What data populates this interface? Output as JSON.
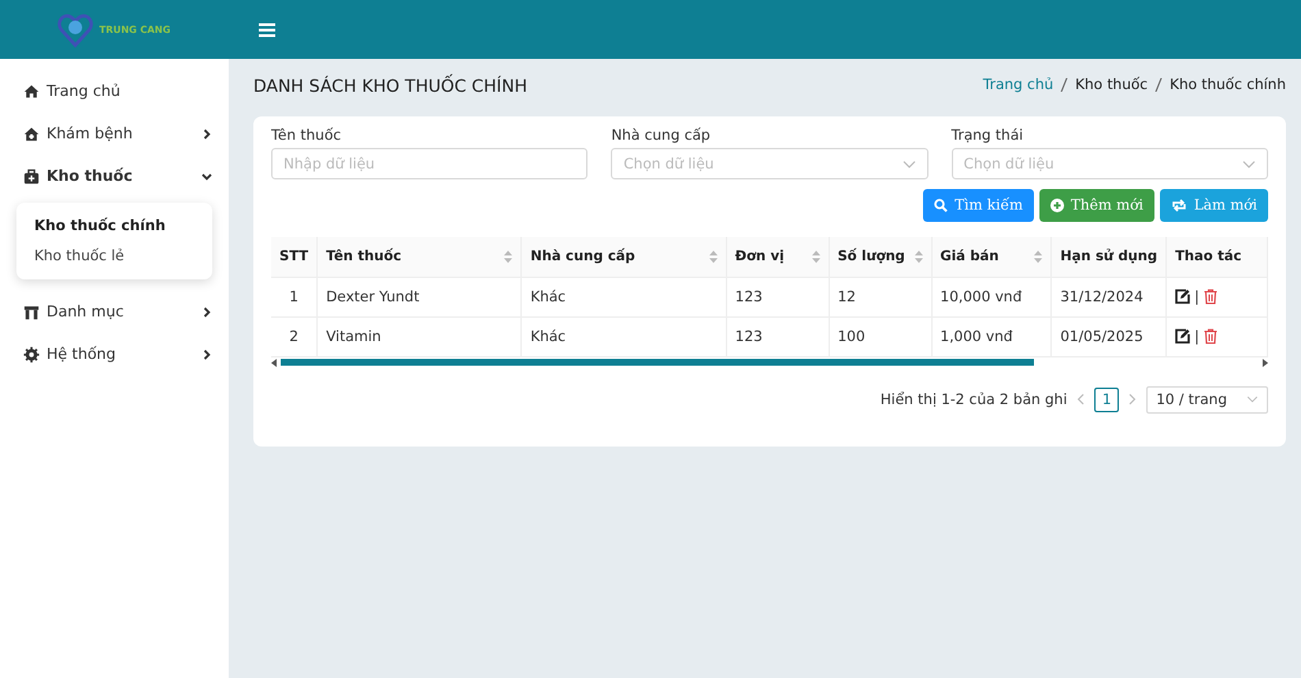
{
  "logo": {
    "text": "TRUNG CANG"
  },
  "page_title": "DANH SÁCH KHO THUỐC CHÍNH",
  "breadcrumb": [
    {
      "label": "Trang chủ",
      "kind": "link"
    },
    {
      "label": "Kho thuốc",
      "kind": "text"
    },
    {
      "label": "Kho thuốc chính",
      "kind": "text"
    }
  ],
  "sidebar": {
    "items": [
      {
        "label": "Trang chủ",
        "kind": "link",
        "active": false
      },
      {
        "label": "Khám bệnh",
        "kind": "group",
        "expanded": false,
        "active": false
      },
      {
        "label": "Kho thuốc",
        "kind": "group",
        "expanded": true,
        "active": true,
        "children": [
          {
            "label": "Kho thuốc chính",
            "selected": true
          },
          {
            "label": "Kho thuốc lẻ",
            "selected": false
          }
        ]
      },
      {
        "label": "Danh mục",
        "kind": "group",
        "expanded": false,
        "active": false
      },
      {
        "label": "Hệ thống",
        "kind": "group",
        "expanded": false,
        "active": false
      }
    ]
  },
  "filters": [
    {
      "label": "Tên thuốc",
      "kind": "input",
      "placeholder": "Nhập dữ liệu"
    },
    {
      "label": "Nhà cung cấp",
      "kind": "select",
      "placeholder": "Chọn dữ liệu"
    },
    {
      "label": "Trạng thái",
      "kind": "select",
      "placeholder": "Chọn dữ liệu"
    }
  ],
  "buttons": [
    {
      "label": "Tìm kiếm",
      "kind": "search",
      "color": "#1890ff"
    },
    {
      "label": "Thêm mới",
      "kind": "add",
      "color": "#3e9e47"
    },
    {
      "label": "Làm mới",
      "kind": "refresh",
      "color": "#1ba3dc"
    }
  ],
  "table": {
    "columns": [
      {
        "label": "STT",
        "sortable": false
      },
      {
        "label": "Tên thuốc",
        "sortable": true
      },
      {
        "label": "Nhà cung cấp",
        "sortable": true
      },
      {
        "label": "Đơn vị",
        "sortable": true
      },
      {
        "label": "Số lượng",
        "sortable": true
      },
      {
        "label": "Giá bán",
        "sortable": true
      },
      {
        "label": "Hạn sử dụng",
        "sortable": false
      },
      {
        "label": "Thao tác",
        "sortable": false
      }
    ],
    "rows": [
      {
        "stt": "1",
        "name": "Dexter Yundt",
        "supplier": "Khác",
        "unit": "123",
        "quantity": "12",
        "price": "10,000 vnđ",
        "expiry": "31/12/2024",
        "separator": "|"
      },
      {
        "stt": "2",
        "name": "Vitamin",
        "supplier": "Khác",
        "unit": "123",
        "quantity": "100",
        "price": "1,000 vnđ",
        "expiry": "01/05/2025",
        "separator": "|"
      }
    ]
  },
  "pagination": {
    "summary": "Hiển thị 1-2 của 2 bản ghi",
    "pages": [
      {
        "label": "1",
        "selected": true
      }
    ],
    "page_size": "10 / trang"
  }
}
